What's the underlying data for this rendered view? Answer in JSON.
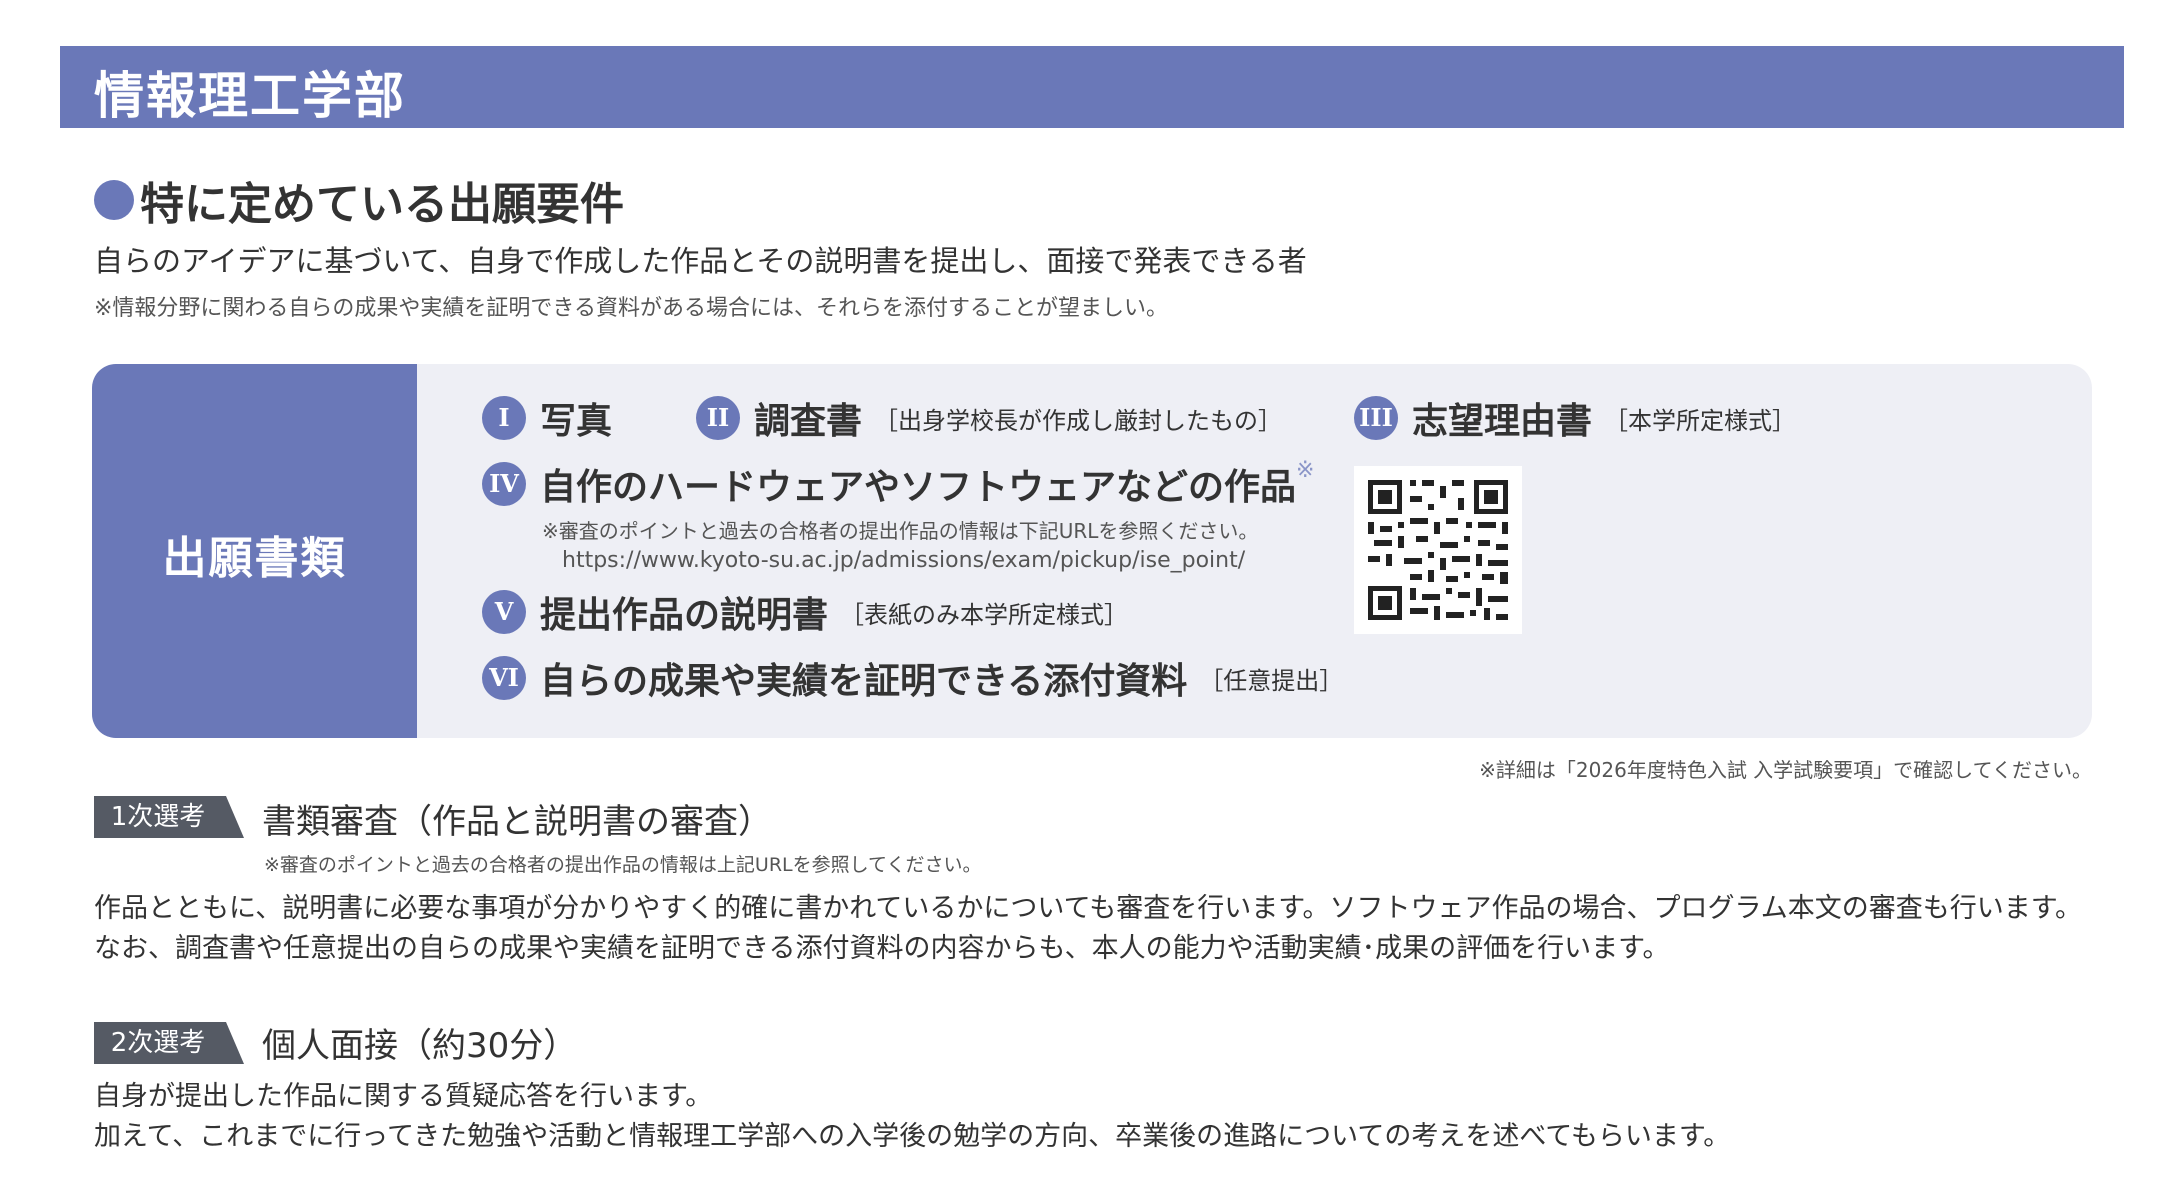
{
  "header": {
    "title": "情報理工学部"
  },
  "requirements": {
    "heading": "特に定めている出願要件",
    "text": "自らのアイデアに基づいて、自身で作成した作品とその説明書を提出し、面接で発表できる者",
    "note": "※情報分野に関わる自らの成果や実績を証明できる資料がある場合には、それらを添付することが望ましい。"
  },
  "documents": {
    "label": "出願書類",
    "items": [
      {
        "num": "I",
        "name": "写真",
        "sub": ""
      },
      {
        "num": "II",
        "name": "調査書",
        "sub": "［出身学校長が作成し厳封したもの］"
      },
      {
        "num": "III",
        "name": "志望理由書",
        "sub": "［本学所定様式］"
      },
      {
        "num": "IV",
        "name": "自作のハードウェアやソフトウェアなどの作品",
        "sub": "※"
      },
      {
        "num": "V",
        "name": "提出作品の説明書",
        "sub": "［表紙のみ本学所定様式］"
      },
      {
        "num": "VI",
        "name": "自らの成果や実績を証明できる添付資料",
        "sub": "［任意提出］"
      }
    ],
    "works_note": "※審査のポイントと過去の合格者の提出作品の情報は下記URLを参照ください。",
    "works_url": "https://www.kyoto-su.ac.jp/admissions/exam/pickup/ise_point/"
  },
  "detail_note": "※詳細は「2026年度特色入試 入学試験要項」で確認してください。",
  "stages": [
    {
      "tag": "1次選考",
      "title": "書類審査（作品と説明書の審査）",
      "note": "※審査のポイントと過去の合格者の提出作品の情報は上記URLを参照してください。",
      "body": [
        "作品とともに、説明書に必要な事項が分かりやすく的確に書かれているかについても審査を行います。ソフトウェア作品の場合、プログラム本文の審査も行います。",
        "なお、調査書や任意提出の自らの成果や実績を証明できる添付資料の内容からも、本人の能力や活動実績･成果の評価を行います。"
      ]
    },
    {
      "tag": "2次選考",
      "title": "個人面接（約30分）",
      "note": "",
      "body": [
        "自身が提出した作品に関する質疑応答を行います。",
        "加えて、これまでに行ってきた勉強や活動と情報理工学部への入学後の勉学の方向、卒業後の進路についての考えを述べてもらいます。"
      ]
    }
  ],
  "colors": {
    "accent": "#6a78b8",
    "panel_bg": "#eeeff5",
    "tag_bg": "#555a64"
  },
  "icons": {
    "qr": "qr-code-icon"
  }
}
